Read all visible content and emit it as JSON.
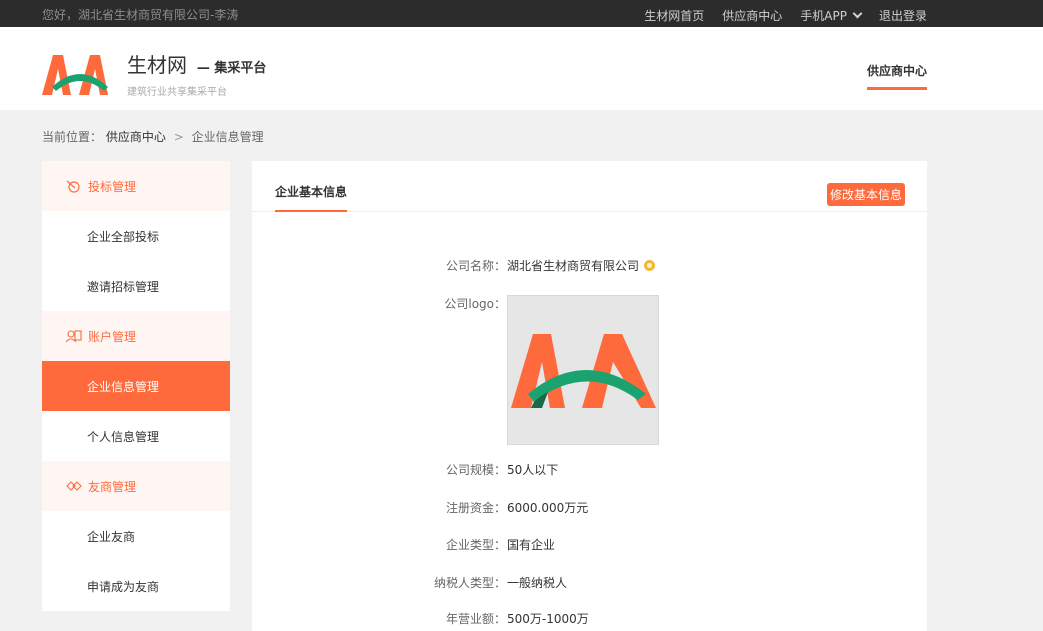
{
  "topbar": {
    "greeting": "您好，湖北省生材商贸有限公司-李涛",
    "links": [
      "生材网首页",
      "供应商中心",
      "手机APP",
      "退出登录"
    ]
  },
  "header": {
    "brand_name": "生材网",
    "brand_suffix": "— 集采平台",
    "tagline": "建筑行业共享集采平台",
    "nav_active": "供应商中心"
  },
  "breadcrumb": {
    "prefix": "当前位置：",
    "level1": "供应商中心",
    "separator": ">",
    "level2": "企业信息管理"
  },
  "sidebar": {
    "groups": [
      {
        "label": "投标管理",
        "icon": "bid-icon",
        "items": [
          "企业全部投标",
          "邀请招标管理"
        ]
      },
      {
        "label": "账户管理",
        "icon": "account-icon",
        "items": [
          "企业信息管理",
          "个人信息管理"
        ]
      },
      {
        "label": "友商管理",
        "icon": "partner-icon",
        "items": [
          "企业友商",
          "申请成为友商"
        ]
      }
    ],
    "active_item": "企业信息管理"
  },
  "main": {
    "tab": "企业基本信息",
    "edit_button": "修改基本信息",
    "fields": {
      "company_name": {
        "label": "公司名称：",
        "value": "湖北省生材商贸有限公司"
      },
      "logo": {
        "label": "公司logo："
      },
      "scale": {
        "label": "公司规模：",
        "value": "50人以下"
      },
      "capital": {
        "label": "注册资金：",
        "value": "6000.000万元"
      },
      "type": {
        "label": "企业类型：",
        "value": "国有企业"
      },
      "taxpayer": {
        "label": "纳税人类型：",
        "value": "一般纳税人"
      },
      "revenue": {
        "label": "年营业额：",
        "value": "500万-1000万"
      }
    }
  },
  "colors": {
    "accent": "#ff6a3d",
    "logo_green": "#1aa36f",
    "topbar_bg": "#2c2c2c"
  }
}
